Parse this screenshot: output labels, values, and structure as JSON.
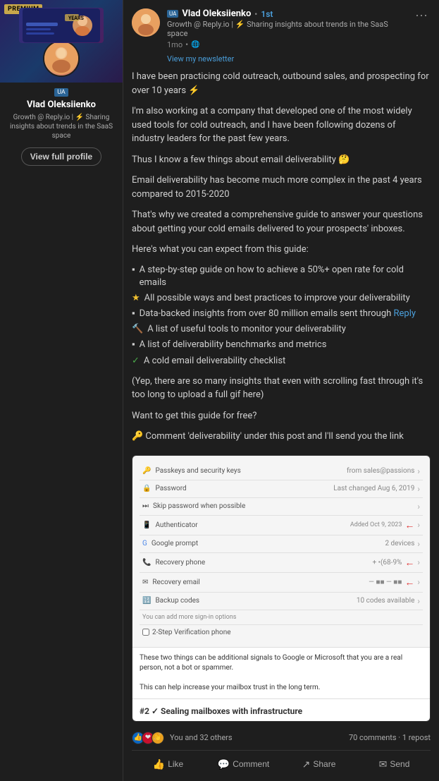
{
  "sidebar": {
    "premium_label": "PREMIUM",
    "ua_badge": "UA",
    "profile_name": "Vlad Oleksiienko",
    "profile_desc_line1": "Growth @ Reply.io | ⚡ Sharing",
    "profile_desc_line2": "insights about trends in the SaaS",
    "profile_desc_line3": "space",
    "view_profile_btn": "View full profile"
  },
  "post": {
    "header": {
      "ua_badge": "UA",
      "author_name": "Vlad Oleksiienko",
      "connection": "1st",
      "author_title": "Growth @ Reply.io | ⚡ Sharing insights about trends in the SaaS space",
      "time": "1mo",
      "newsletter_link": "View my newsletter"
    },
    "paragraphs": [
      "I have been practicing cold outreach, outbound sales, and prospecting for over 10 years ⚡",
      "I'm also working at a company that developed one of the most widely used tools for cold outreach, and I have been following dozens of industry leaders for the past few years.",
      "Thus I know a few things about email deliverability 🤔",
      "Email deliverability has become much more complex in the past 4 years compared to 2015-2020",
      "That's why we created a comprehensive guide to answer your questions about getting your cold emails delivered to your prospects' inboxes.",
      "Here's what you can expect from this guide:"
    ],
    "bullets": [
      {
        "icon": "▪",
        "text": "A step-by-step guide on how to achieve a 50%+ open rate for cold emails"
      },
      {
        "icon": "★",
        "text": "All possible ways and best practices to improve your deliverability"
      },
      {
        "icon": "▪",
        "text": "Data-backed insights from over 80 million emails sent through Reply"
      },
      {
        "icon": "🔨",
        "text": "A list of useful tools to monitor your deliverability"
      },
      {
        "icon": "▪",
        "text": "A list of deliverability benchmarks and metrics"
      },
      {
        "icon": "✓",
        "text": "A cold email deliverability checklist"
      }
    ],
    "paragraphs2": [
      "(Yep, there are so many insights that even with scrolling fast through it's too long to upload a full gif here)",
      "Want to get this guide for free?",
      "🔑 Comment 'deliverability' under this post and I'll send you the link"
    ],
    "screenshot": {
      "rows": [
        {
          "label": "Passkeys and security keys",
          "value": "from sales@passions",
          "has_arrow": true,
          "red_arrow": false
        },
        {
          "label": "Password",
          "value": "Last changed Aug 6, 2019",
          "has_arrow": true,
          "red_arrow": false
        },
        {
          "label": "Skip password when possible",
          "value": "",
          "has_arrow": true,
          "red_arrow": false
        },
        {
          "label": "Authenticator",
          "value": "Added Oct 9, 2023",
          "has_arrow": true,
          "red_arrow": true
        },
        {
          "label": "Google prompt",
          "value": "2 devices",
          "has_arrow": true,
          "red_arrow": false
        },
        {
          "label": "Recovery phone",
          "value": "+•(68-9%",
          "has_arrow": true,
          "red_arrow": true
        },
        {
          "label": "Recovery email",
          "value": "— ■■ — ■■",
          "has_arrow": true,
          "red_arrow": true
        },
        {
          "label": "Backup codes",
          "value": "10 codes available",
          "has_arrow": true,
          "red_arrow": false
        },
        {
          "label": "You can add more sign-in options",
          "value": "",
          "has_arrow": false,
          "red_arrow": false
        },
        {
          "label": "2-Step Verification phone",
          "value": "",
          "has_arrow": false,
          "red_arrow": false
        }
      ],
      "bottom_text": "These two things can be additional signals to Google or Microsoft that you are a real person, not a bot or spammer.",
      "bottom_text2": "This can help increase your mailbox trust in the long term.",
      "section_heading": "#2 ✓ Sealing mailboxes with infrastructure"
    },
    "footer": {
      "reactions_label": "You and 32 others",
      "comments_label": "70 comments · 1 repost",
      "like_btn": "Like",
      "comment_btn": "Comment",
      "share_btn": "Share",
      "send_btn": "Send"
    }
  }
}
